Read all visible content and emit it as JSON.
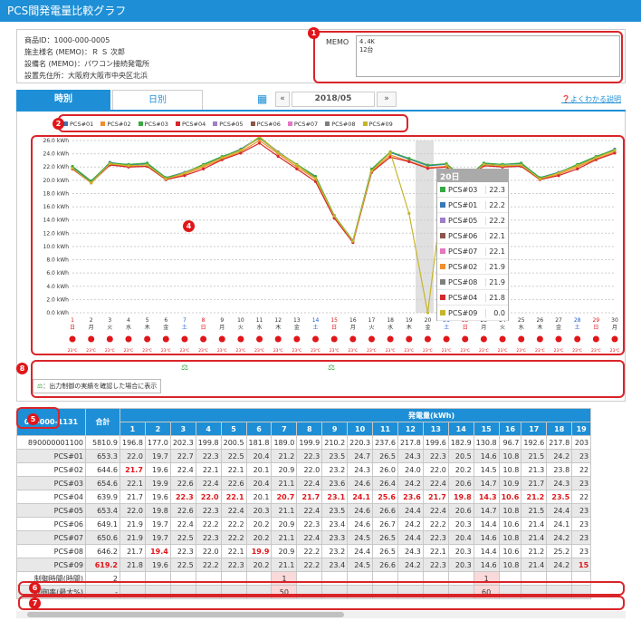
{
  "header": {
    "title": "PCS間発電量比較グラフ"
  },
  "info": {
    "id": "商品ID：1000-000-0005",
    "owner": "施主様名 (MEMO)：Ｒ Ｓ 次郎",
    "equip": "設備名 (MEMO)：パワコン接続発電所",
    "place": "設置先住所：大阪府大阪市中央区北浜"
  },
  "memo": {
    "label": "MEMO",
    "value": "4.4K\n12台"
  },
  "tabs": {
    "hourly": "時別",
    "daily": "日別"
  },
  "nav": {
    "prev": "«",
    "month": "2018/05",
    "next": "»",
    "help": "❓よくわかる説明"
  },
  "annotations": [
    "1",
    "2",
    "3",
    "4",
    "5",
    "6",
    "7",
    "8"
  ],
  "colors": {
    "accent": "#1e8fd6",
    "red": "#e0161a"
  },
  "legend": [
    {
      "name": "PCS#01",
      "color": "#3a76b8"
    },
    {
      "name": "PCS#02",
      "color": "#f28e2b"
    },
    {
      "name": "PCS#03",
      "color": "#3aa843"
    },
    {
      "name": "PCS#04",
      "color": "#d6282b"
    },
    {
      "name": "PCS#05",
      "color": "#9f7fc7"
    },
    {
      "name": "PCS#06",
      "color": "#8c564b"
    },
    {
      "name": "PCS#07",
      "color": "#e377c2"
    },
    {
      "name": "PCS#08",
      "color": "#7f7f7f"
    },
    {
      "name": "PCS#09",
      "color": "#c7b62a"
    }
  ],
  "chart_data": {
    "type": "line",
    "ylim": [
      0,
      26
    ],
    "yticks": [
      "0.0 kWh",
      "2.0 kWh",
      "4.0 kWh",
      "6.0 kWh",
      "8.0 kWh",
      "10.0 kWh",
      "12.0 kWh",
      "14.0 kWh",
      "16.0 kWh",
      "18.0 kWh",
      "20.0 kWh",
      "22.0 kWh",
      "24.0 kWh",
      "26.0 kWh"
    ],
    "days": [
      "1",
      "2",
      "3",
      "4",
      "5",
      "6",
      "7",
      "8",
      "9",
      "10",
      "11",
      "12",
      "13",
      "14",
      "15",
      "16",
      "17",
      "18",
      "19",
      "20",
      "21",
      "22",
      "23",
      "24",
      "25",
      "26",
      "27",
      "28",
      "29",
      "30"
    ],
    "weekdays": [
      "日",
      "月",
      "火",
      "水",
      "木",
      "金",
      "土",
      "日",
      "月",
      "火",
      "水",
      "木",
      "金",
      "土",
      "日",
      "月",
      "火",
      "水",
      "木",
      "金",
      "土",
      "日",
      "月",
      "火",
      "水",
      "木",
      "金",
      "土",
      "日",
      "月"
    ],
    "series": [
      {
        "name": "PCS#01",
        "values": [
          22.0,
          19.7,
          22.7,
          22.3,
          22.5,
          20.4,
          21.2,
          22.3,
          23.5,
          24.7,
          26.5,
          24.3,
          22.3,
          20.5,
          14.6,
          10.8,
          21.5,
          24.2,
          23.2,
          22.2,
          22.4,
          20.1,
          22.5,
          22.4,
          22.5,
          20.4,
          21.2,
          22.3,
          23.5,
          24.7
        ]
      },
      {
        "name": "PCS#02",
        "values": [
          21.7,
          19.6,
          22.4,
          22.1,
          22.1,
          20.1,
          20.9,
          22.0,
          23.2,
          24.3,
          26.0,
          24.0,
          22.0,
          20.2,
          14.5,
          10.8,
          21.3,
          23.8,
          22.9,
          21.9,
          22.1,
          19.8,
          22.2,
          22.1,
          22.2,
          20.1,
          20.9,
          22.0,
          23.2,
          24.3
        ]
      },
      {
        "name": "PCS#03",
        "values": [
          22.1,
          19.9,
          22.6,
          22.4,
          22.6,
          20.4,
          21.1,
          22.4,
          23.6,
          24.6,
          26.4,
          24.2,
          22.4,
          20.6,
          14.7,
          10.9,
          21.7,
          24.3,
          23.3,
          22.3,
          22.5,
          20.2,
          22.6,
          22.4,
          22.6,
          20.4,
          21.1,
          22.4,
          23.6,
          24.6
        ]
      },
      {
        "name": "PCS#04",
        "values": [
          21.7,
          19.6,
          22.3,
          22.0,
          22.1,
          20.1,
          20.7,
          21.7,
          23.1,
          24.1,
          25.6,
          23.6,
          21.7,
          19.8,
          14.3,
          10.6,
          21.2,
          23.5,
          22.8,
          21.8,
          22.0,
          19.7,
          22.2,
          22.0,
          22.1,
          20.1,
          20.7,
          21.7,
          23.1,
          24.1
        ]
      },
      {
        "name": "PCS#09",
        "values": [
          21.8,
          19.6,
          22.5,
          22.2,
          22.3,
          20.2,
          21.1,
          22.2,
          23.4,
          24.5,
          26.6,
          24.2,
          22.3,
          20.3,
          14.6,
          10.8,
          21.4,
          24.2,
          15.0,
          0.0,
          22.3,
          20.0,
          22.4,
          22.2,
          22.3,
          20.2,
          21.1,
          22.2,
          23.4,
          24.5
        ]
      }
    ],
    "tooltip": {
      "title": "20日",
      "rows": [
        {
          "name": "PCS#03",
          "value": "22.3"
        },
        {
          "name": "PCS#01",
          "value": "22.2"
        },
        {
          "name": "PCS#05",
          "value": "22.2"
        },
        {
          "name": "PCS#06",
          "value": "22.1"
        },
        {
          "name": "PCS#07",
          "value": "22.1"
        },
        {
          "name": "PCS#02",
          "value": "21.9"
        },
        {
          "name": "PCS#08",
          "value": "21.9"
        },
        {
          "name": "PCS#04",
          "value": "21.8"
        },
        {
          "name": "PCS#09",
          "value": "0.0"
        }
      ]
    }
  },
  "weather_temp": "23℃",
  "note": {
    "text": "：出力制御の実績を確認した場合に表示"
  },
  "table": {
    "header_label": "0…-000-1131",
    "total_label": "合計",
    "kwh_label": "発電量(kWh)",
    "days": [
      "1",
      "2",
      "3",
      "4",
      "5",
      "6",
      "7",
      "8",
      "9",
      "10",
      "11",
      "12",
      "13",
      "14",
      "15",
      "16",
      "17",
      "18",
      "19"
    ],
    "rows": [
      {
        "name": "890000001100",
        "total": "5810.9",
        "vals": [
          "196.8",
          "177.0",
          "202.3",
          "199.8",
          "200.5",
          "181.8",
          "189.0",
          "199.9",
          "210.2",
          "220.3",
          "237.6",
          "217.8",
          "199.6",
          "182.9",
          "130.8",
          "96.7",
          "192.6",
          "217.8",
          "203"
        ],
        "red": []
      },
      {
        "name": "PCS#01",
        "total": "653.3",
        "vals": [
          "22.0",
          "19.7",
          "22.7",
          "22.3",
          "22.5",
          "20.4",
          "21.2",
          "22.3",
          "23.5",
          "24.7",
          "26.5",
          "24.3",
          "22.3",
          "20.5",
          "14.6",
          "10.8",
          "21.5",
          "24.2",
          "23"
        ],
        "red": []
      },
      {
        "name": "PCS#02",
        "total": "644.6",
        "vals": [
          "21.7",
          "19.6",
          "22.4",
          "22.1",
          "22.1",
          "20.1",
          "20.9",
          "22.0",
          "23.2",
          "24.3",
          "26.0",
          "24.0",
          "22.0",
          "20.2",
          "14.5",
          "10.8",
          "21.3",
          "23.8",
          "22"
        ],
        "red": [
          0
        ]
      },
      {
        "name": "PCS#03",
        "total": "654.6",
        "vals": [
          "22.1",
          "19.9",
          "22.6",
          "22.4",
          "22.6",
          "20.4",
          "21.1",
          "22.4",
          "23.6",
          "24.6",
          "26.4",
          "24.2",
          "22.4",
          "20.6",
          "14.7",
          "10.9",
          "21.7",
          "24.3",
          "23"
        ],
        "red": []
      },
      {
        "name": "PCS#04",
        "total": "639.9",
        "vals": [
          "21.7",
          "19.6",
          "22.3",
          "22.0",
          "22.1",
          "20.1",
          "20.7",
          "21.7",
          "23.1",
          "24.1",
          "25.6",
          "23.6",
          "21.7",
          "19.8",
          "14.3",
          "10.6",
          "21.2",
          "23.5",
          "22"
        ],
        "red": [
          2,
          3,
          4,
          6,
          7,
          8,
          9,
          10,
          11,
          12,
          13,
          14,
          15,
          16,
          17
        ]
      },
      {
        "name": "PCS#05",
        "total": "653.4",
        "vals": [
          "22.0",
          "19.8",
          "22.6",
          "22.3",
          "22.4",
          "20.3",
          "21.1",
          "22.4",
          "23.5",
          "24.6",
          "26.6",
          "24.4",
          "22.4",
          "20.6",
          "14.7",
          "10.8",
          "21.5",
          "24.4",
          "23"
        ],
        "red": []
      },
      {
        "name": "PCS#06",
        "total": "649.1",
        "vals": [
          "21.9",
          "19.7",
          "22.4",
          "22.2",
          "22.2",
          "20.2",
          "20.9",
          "22.3",
          "23.4",
          "24.6",
          "26.7",
          "24.2",
          "22.2",
          "20.3",
          "14.4",
          "10.6",
          "21.4",
          "24.1",
          "23"
        ],
        "red": []
      },
      {
        "name": "PCS#07",
        "total": "650.6",
        "vals": [
          "21.9",
          "19.7",
          "22.5",
          "22.3",
          "22.2",
          "20.2",
          "21.1",
          "22.4",
          "23.3",
          "24.5",
          "26.5",
          "24.4",
          "22.3",
          "20.4",
          "14.6",
          "10.8",
          "21.4",
          "24.2",
          "23"
        ],
        "red": []
      },
      {
        "name": "PCS#08",
        "total": "646.2",
        "vals": [
          "21.7",
          "19.4",
          "22.3",
          "22.0",
          "22.1",
          "19.9",
          "20.9",
          "22.2",
          "23.2",
          "24.4",
          "26.5",
          "24.3",
          "22.1",
          "20.3",
          "14.4",
          "10.6",
          "21.2",
          "25.2",
          "23"
        ],
        "red": [
          1,
          5
        ]
      },
      {
        "name": "PCS#09",
        "total": "619.2",
        "vals": [
          "21.8",
          "19.6",
          "22.5",
          "22.2",
          "22.3",
          "20.2",
          "21.1",
          "22.2",
          "23.4",
          "24.5",
          "26.6",
          "24.2",
          "22.3",
          "20.3",
          "14.6",
          "10.8",
          "21.4",
          "24.2",
          "15"
        ],
        "red": [
          18
        ],
        "redtotal": true
      },
      {
        "name": "制御時間(時間)",
        "total": "2",
        "vals": [
          "",
          "",
          "",
          "",
          "",
          "",
          "1",
          "",
          "",
          "",
          "",
          "",
          "",
          "",
          "1",
          "",
          "",
          "",
          ""
        ],
        "red": []
      },
      {
        "name": "制御率(最大%)",
        "total": "-",
        "vals": [
          "",
          "",
          "",
          "",
          "",
          "",
          "50",
          "",
          "",
          "",
          "",
          "",
          "",
          "",
          "60",
          "",
          "",
          "",
          ""
        ],
        "red": []
      }
    ]
  }
}
